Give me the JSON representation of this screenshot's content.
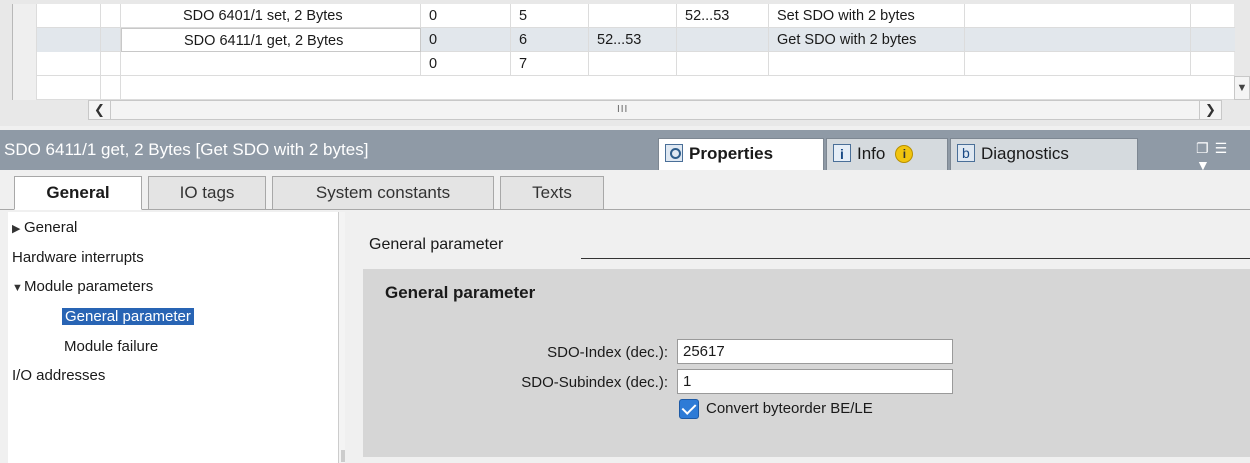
{
  "table": {
    "rows": [
      {
        "name": "SDO 6401/1 set, 2 Bytes",
        "c4": "0",
        "c5": "5",
        "c6": "",
        "c7": "52...53",
        "comment": "Set SDO with 2 bytes"
      },
      {
        "name": "SDO 6411/1 get, 2 Bytes",
        "c4": "0",
        "c5": "6",
        "c6": "52...53",
        "c7": "",
        "comment": "Get SDO with 2 bytes"
      },
      {
        "name": "",
        "c4": "0",
        "c5": "7",
        "c6": "",
        "c7": "",
        "comment": ""
      }
    ],
    "scroll_grip": "III"
  },
  "inspector": {
    "title": "SDO 6411/1 get, 2 Bytes [Get SDO with 2 bytes]",
    "tabs": {
      "properties": "Properties",
      "info": "Info",
      "diagnostics": "Diagnostics"
    },
    "info_badge": "i"
  },
  "subtabs": [
    "General",
    "IO tags",
    "System constants",
    "Texts"
  ],
  "nav": {
    "items": [
      "General",
      "Hardware interrupts",
      "Module parameters",
      "General parameter",
      "Module failure",
      "I/O addresses"
    ],
    "selected": "General parameter"
  },
  "content": {
    "section": "General parameter",
    "panel_title": "General parameter",
    "fields": {
      "index_label": "SDO-Index (dec.):",
      "index_value": "25617",
      "subindex_label": "SDO-Subindex (dec.):",
      "subindex_value": "1",
      "checkbox_label": "Convert byteorder BE/LE",
      "checkbox_checked": true
    }
  },
  "colors": {
    "title_bar": "#8f9aa6",
    "selection": "#2864b4",
    "checkbox": "#2e7bd6"
  }
}
